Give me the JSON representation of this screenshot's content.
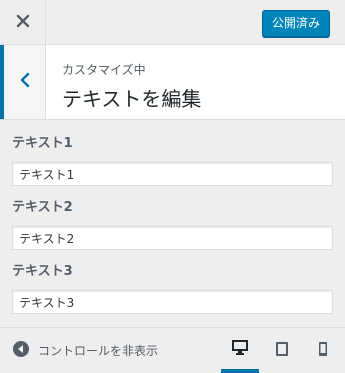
{
  "header": {
    "close_icon": "close-icon",
    "publish_label": "公開済み"
  },
  "section": {
    "customizing_label": "カスタマイズ中",
    "title": "テキストを編集"
  },
  "controls": [
    {
      "label": "テキスト1",
      "value": "テキスト1"
    },
    {
      "label": "テキスト2",
      "value": "テキスト2"
    },
    {
      "label": "テキスト3",
      "value": "テキスト3"
    }
  ],
  "footer": {
    "collapse_label": "コントロールを非表示",
    "devices": [
      {
        "name": "desktop",
        "icon": "desktop-icon",
        "active": true
      },
      {
        "name": "tablet",
        "icon": "tablet-icon",
        "active": false
      },
      {
        "name": "mobile",
        "icon": "mobile-icon",
        "active": false
      }
    ]
  },
  "colors": {
    "accent": "#0073aa",
    "publish_bg": "#0085ba",
    "panel_bg": "#eeeeee"
  }
}
